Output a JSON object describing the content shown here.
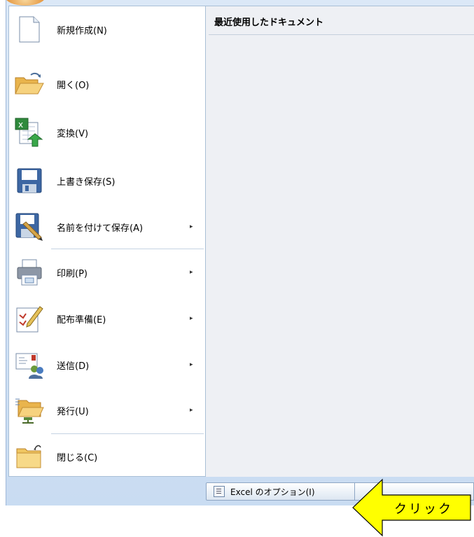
{
  "recent": {
    "title": "最近使用したドキュメント"
  },
  "menu": {
    "new": "新規作成(N)",
    "open": "開く(O)",
    "convert": "変換(V)",
    "save": "上書き保存(S)",
    "save_as": "名前を付けて保存(A)",
    "print": "印刷(P)",
    "prepare": "配布準備(E)",
    "send": "送信(D)",
    "publish": "発行(U)",
    "close": "閉じる(C)"
  },
  "submenu_arrow": "▸",
  "bottom": {
    "options_label": "Excel のオプション(I)"
  },
  "callout": {
    "text": "クリック",
    "color": "#ffff00"
  }
}
